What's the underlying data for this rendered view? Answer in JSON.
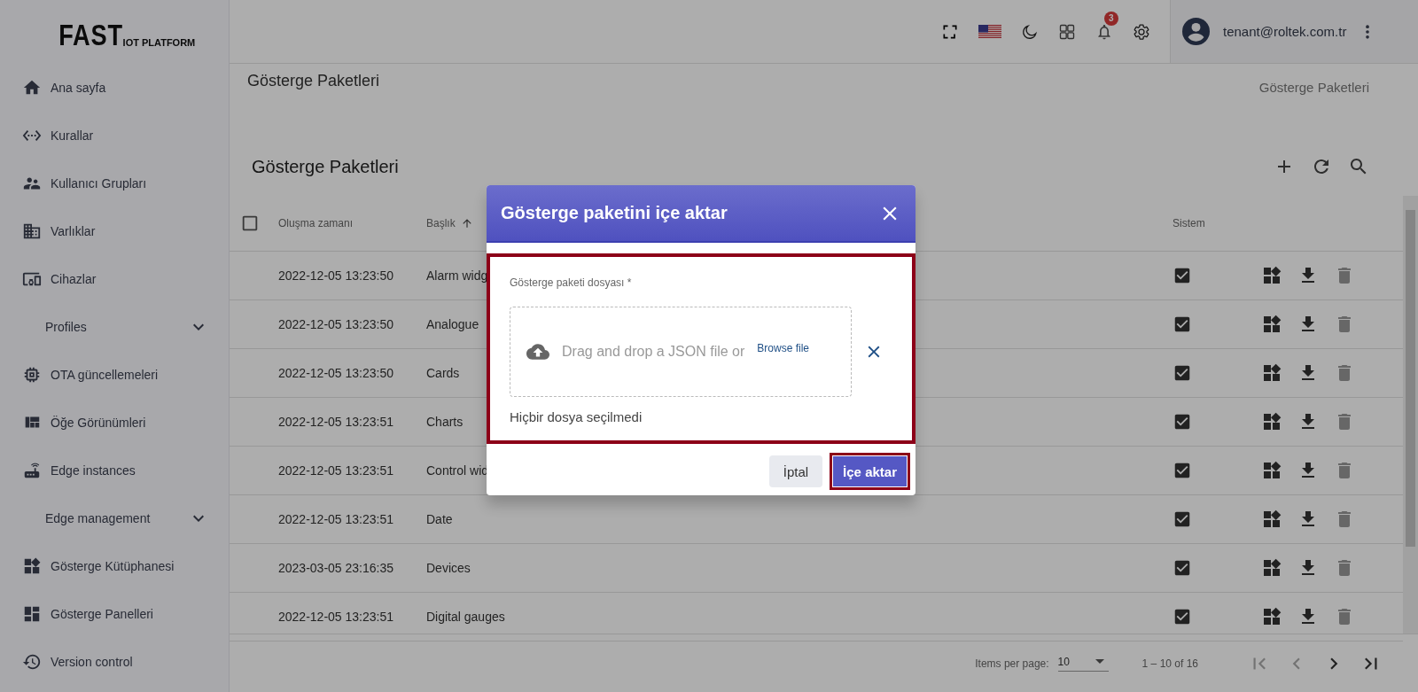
{
  "logo": {
    "main": "FAST",
    "sub": "IOT PLATFORM"
  },
  "sidebar": {
    "items": [
      {
        "kind": "link",
        "label": "Ana sayfa"
      },
      {
        "kind": "link",
        "label": "Kurallar"
      },
      {
        "kind": "link",
        "label": "Kullanıcı Grupları"
      },
      {
        "kind": "link",
        "label": "Varlıklar"
      },
      {
        "kind": "link",
        "label": "Cihazlar"
      },
      {
        "kind": "group",
        "label": "Profiles",
        "expanded": false
      },
      {
        "kind": "link",
        "label": "OTA güncellemeleri"
      },
      {
        "kind": "link",
        "label": "Öğe Görünümleri"
      },
      {
        "kind": "link",
        "label": "Edge instances"
      },
      {
        "kind": "group",
        "label": "Edge management",
        "expanded": false
      },
      {
        "kind": "link",
        "label": "Gösterge Kütüphanesi"
      },
      {
        "kind": "link",
        "label": "Gösterge Panelleri"
      },
      {
        "kind": "link",
        "label": "Version control"
      }
    ]
  },
  "topbar": {
    "notifications_badge": "3",
    "user_email": "tenant@roltek.com.tr"
  },
  "page": {
    "title": "Gösterge Paketleri",
    "breadcrumb": "Gösterge Paketleri"
  },
  "card": {
    "title": "Gösterge Paketleri"
  },
  "table": {
    "select_all_checked": false,
    "columns": [
      {
        "label": "Oluşma zamanı",
        "sorted": false
      },
      {
        "label": "Başlık",
        "sorted": true
      },
      {
        "label": "Sistem",
        "sorted": false
      }
    ],
    "rows": [
      {
        "created": "2022-12-05 13:23:50",
        "title": "Alarm widg",
        "system": true,
        "delete_disabled": true
      },
      {
        "created": "2022-12-05 13:23:50",
        "title": "Analogue",
        "system": true,
        "delete_disabled": true
      },
      {
        "created": "2022-12-05 13:23:50",
        "title": "Cards",
        "system": true,
        "delete_disabled": true
      },
      {
        "created": "2022-12-05 13:23:51",
        "title": "Charts",
        "system": true,
        "delete_disabled": true
      },
      {
        "created": "2022-12-05 13:23:51",
        "title": "Control wid",
        "system": true,
        "delete_disabled": true
      },
      {
        "created": "2022-12-05 13:23:51",
        "title": "Date",
        "system": true,
        "delete_disabled": true
      },
      {
        "created": "2023-03-05 23:16:35",
        "title": "Devices",
        "system": true,
        "delete_disabled": true
      },
      {
        "created": "2022-12-05 13:23:51",
        "title": "Digital gauges",
        "system": true,
        "delete_disabled": true
      }
    ]
  },
  "pagination": {
    "items_per_page_label": "Items per page:",
    "page_size": "10",
    "range": "1 – 10 of 16",
    "first_disabled": true,
    "prev_disabled": true,
    "next_disabled": false,
    "last_disabled": false
  },
  "dialog": {
    "title": "Gösterge paketini içe aktar",
    "field_label": "Gösterge paketi dosyası *",
    "drop_text": "Drag and drop a JSON file or",
    "browse_label": "Browse file",
    "status": "Hiçbir dosya seçilmedi",
    "highlighted": true,
    "buttons": [
      {
        "kind": "cancel",
        "label": "İptal",
        "highlighted": false
      },
      {
        "kind": "primary",
        "label": "İçe aktar",
        "highlighted": true
      }
    ]
  }
}
